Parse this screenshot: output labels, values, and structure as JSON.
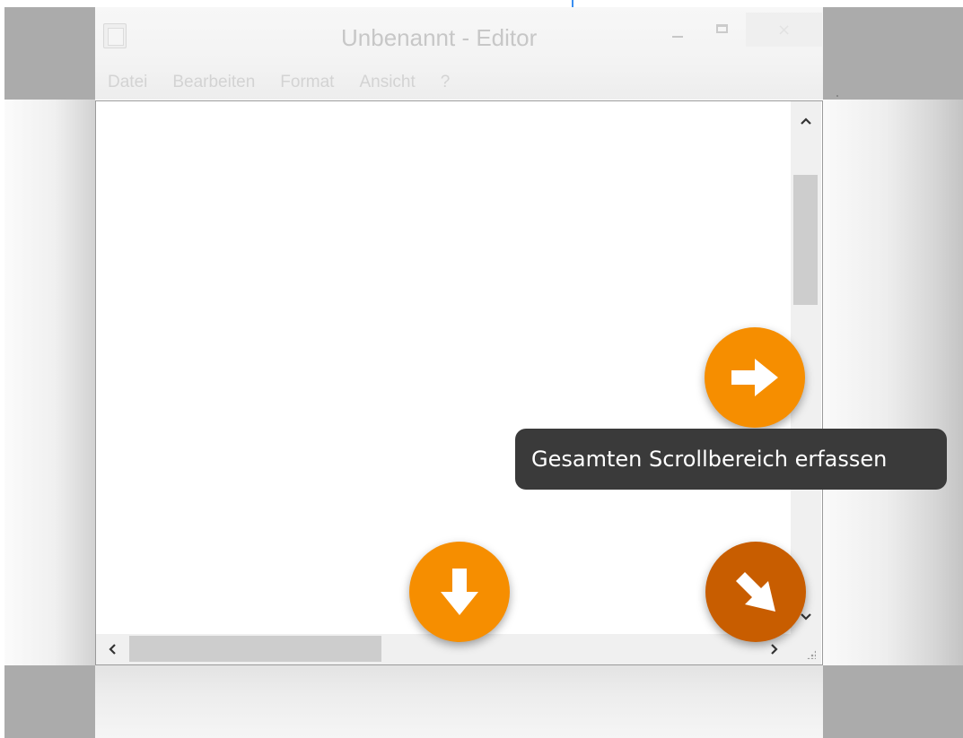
{
  "window": {
    "title": "Unbenannt - Editor",
    "close_glyph": "×",
    "minimize_icon": "minimize-icon",
    "maximize_icon": "maximize-icon",
    "close_icon": "close-icon"
  },
  "menu": {
    "items": [
      "Datei",
      "Bearbeiten",
      "Format",
      "Ansicht",
      "?"
    ]
  },
  "scrollbars": {
    "up_glyph": "⌃",
    "down_glyph": "⌄",
    "left_glyph": "‹",
    "right_glyph": "›"
  },
  "capture": {
    "right_icon": "arrow-right-icon",
    "down_icon": "arrow-down-icon",
    "all_icon": "arrow-down-right-icon",
    "tooltip": "Gesamten Scrollbereich erfassen",
    "colors": {
      "primary": "#f68e00",
      "active": "#c85d00",
      "tooltip_bg": "#3a3a3a"
    }
  }
}
